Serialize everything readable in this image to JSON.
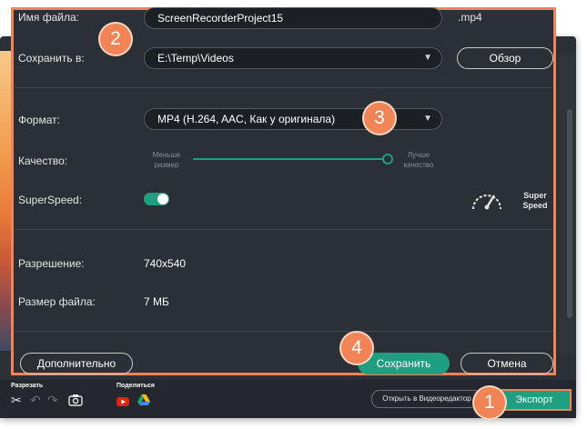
{
  "dialog": {
    "filename_label": "Имя файла:",
    "filename_value": "ScreenRecorderProject15",
    "extension": ".mp4",
    "save_to_label": "Сохранить в:",
    "save_to_value": "E:\\Temp\\Videos",
    "browse_label": "Обзор",
    "format_label": "Формат:",
    "format_value": "MP4 (H.264, AAC, Как у оригинала)",
    "quality_label": "Качество:",
    "quality_left_line1": "Меньше",
    "quality_left_line2": "размер",
    "quality_right_line1": "Лучше",
    "quality_right_line2": "качество",
    "quality_level": 1.0,
    "superspeed_label": "SuperSpeed:",
    "superspeed_on": true,
    "superspeed_text_line1": "Super",
    "superspeed_text_line2": "Speed",
    "resolution_label": "Разрешение:",
    "resolution_value": "740x540",
    "filesize_label": "Размер файла:",
    "filesize_value": "7 МБ",
    "advanced_label": "Дополнительно",
    "save_label": "Сохранить",
    "cancel_label": "Отмена"
  },
  "bottom_bar": {
    "cut_label": "Разрезать",
    "share_label": "Поделиться",
    "open_editor_label": "Открыть в Видеоредактор",
    "export_label": "Экспорт"
  },
  "badges": [
    "1",
    "2",
    "3",
    "4"
  ],
  "colors": {
    "accent": "#1f9e82",
    "highlight": "#f08456",
    "background": "#2b2f36"
  }
}
